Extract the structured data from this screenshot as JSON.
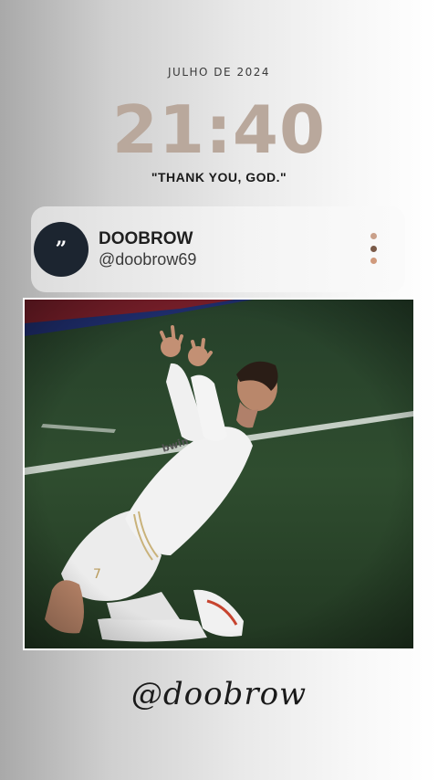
{
  "header": {
    "date": "JULHO DE 2024",
    "time": "21:40",
    "quote": "\"THANK YOU, GOD.\""
  },
  "profile": {
    "avatar_glyph": "”",
    "name": "DOOBROW",
    "handle": "@doobrow69",
    "menu_icon": "more-vertical-icon",
    "menu_dot_colors": [
      "#c9a08a",
      "#7a5a48",
      "#d09a7c"
    ]
  },
  "photo": {
    "subject": "photo-of-player-kneeling-on-pitch",
    "jersey_number": "7"
  },
  "footer": {
    "signature": "@doobrow"
  },
  "colors": {
    "clock": "#b9a89c",
    "avatar_bg": "#1c2530",
    "pitch": "#2e4a2c"
  }
}
